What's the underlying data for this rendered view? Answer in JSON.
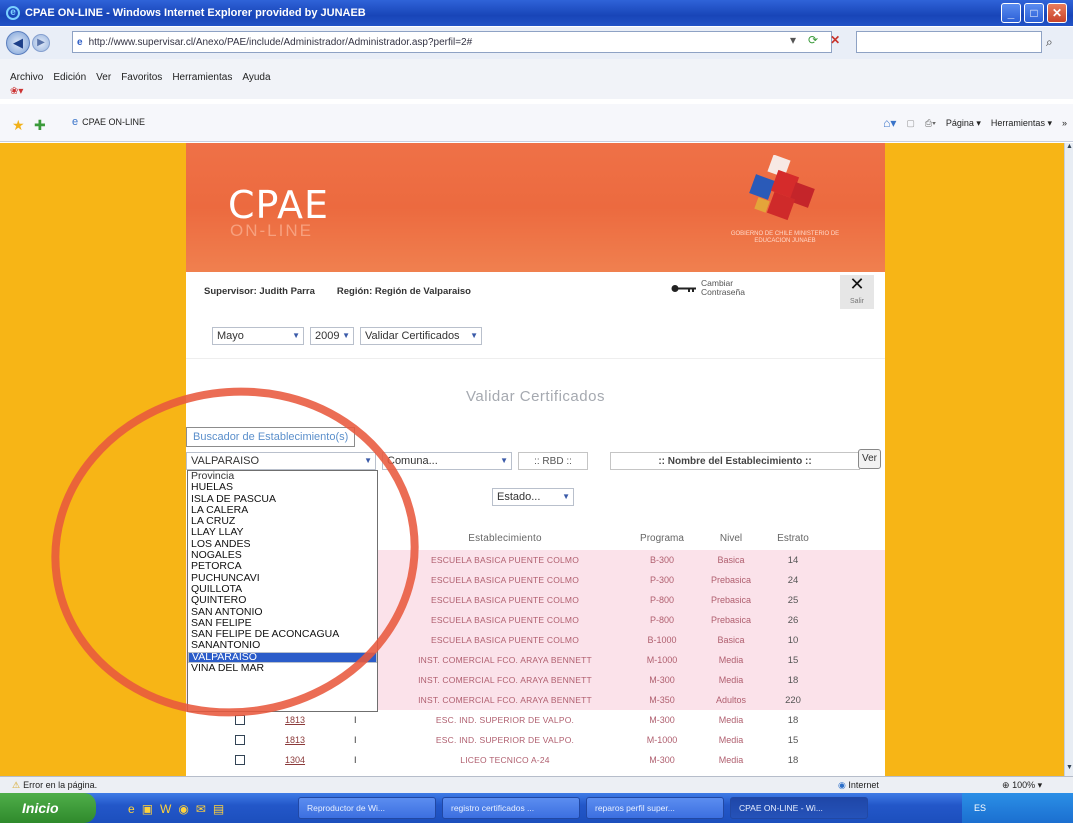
{
  "window": {
    "title": "CPAE ON-LINE - Windows Internet Explorer provided by JUNAEB"
  },
  "address": {
    "url": "http://www.supervisar.cl/Anexo/PAE/include/Administrador/Administrador.asp?perfil=2#"
  },
  "menu": [
    "Archivo",
    "Edición",
    "Ver",
    "Favoritos",
    "Herramientas",
    "Ayuda"
  ],
  "favorites": {
    "tab_label": "CPAE ON-LINE"
  },
  "command_bar": {
    "page_label": "Página",
    "tools_label": "Herramientas"
  },
  "banner": {
    "title": "CPAE",
    "subtitle": "ON-LINE",
    "logo_text": "GOBIERNO DE CHILE MINISTERIO DE EDUCACION JUNAEB"
  },
  "user": {
    "supervisor": "Supervisor: Judith Parra",
    "region": "Región: Región de Valparaiso",
    "change_password": "Cambiar Contraseña",
    "exit": "Salir"
  },
  "period": {
    "month": "Mayo",
    "year": "2009",
    "action": "Validar Certificados"
  },
  "page_title": "Validar Certificados",
  "search": {
    "legend": "Buscador de Establecimiento(s)",
    "province_value": "VALPARAISO",
    "comuna_placeholder": "Comuna...",
    "rbd_placeholder": ":: RBD ::",
    "name_placeholder": ":: Nombre del Establecimiento ::",
    "go_label": "Ver"
  },
  "estado_filter": "Estado...",
  "province_options": [
    "Provincia",
    "HUELAS",
    "ISLA DE PASCUA",
    "LA CALERA",
    "LA CRUZ",
    "LLAY LLAY",
    "LOS ANDES",
    "NOGALES",
    "PETORCA",
    "PUCHUNCAVI",
    "QUILLOTA",
    "QUINTERO",
    "SAN ANTONIO",
    "SAN FELIPE",
    "SAN FELIPE DE ACONCAGUA",
    "SANANTONIO",
    "VALPARAISO",
    "VINA DEL MAR"
  ],
  "province_selected_index": 16,
  "table": {
    "headers": [
      "Establecimiento",
      "Programa",
      "Nivel",
      "Estrato"
    ],
    "rows": [
      {
        "rbd": "",
        "tipo": "",
        "establecimiento": "ESCUELA BASICA PUENTE COLMO",
        "programa": "B-300",
        "nivel": "Basica",
        "estrato": "14"
      },
      {
        "rbd": "",
        "tipo": "",
        "establecimiento": "ESCUELA BASICA PUENTE COLMO",
        "programa": "P-300",
        "nivel": "Prebasica",
        "estrato": "24"
      },
      {
        "rbd": "",
        "tipo": "",
        "establecimiento": "ESCUELA BASICA PUENTE COLMO",
        "programa": "P-800",
        "nivel": "Prebasica",
        "estrato": "25"
      },
      {
        "rbd": "",
        "tipo": "",
        "establecimiento": "ESCUELA BASICA PUENTE COLMO",
        "programa": "P-800",
        "nivel": "Prebasica",
        "estrato": "26"
      },
      {
        "rbd": "",
        "tipo": "",
        "establecimiento": "ESCUELA BASICA PUENTE COLMO",
        "programa": "B-1000",
        "nivel": "Basica",
        "estrato": "10"
      },
      {
        "rbd": "",
        "tipo": "",
        "establecimiento": "INST. COMERCIAL FCO. ARAYA BENNETT",
        "programa": "M-1000",
        "nivel": "Media",
        "estrato": "15"
      },
      {
        "rbd": "",
        "tipo": "",
        "establecimiento": "INST. COMERCIAL FCO. ARAYA BENNETT",
        "programa": "M-300",
        "nivel": "Media",
        "estrato": "18"
      },
      {
        "rbd": "",
        "tipo": "",
        "establecimiento": "INST. COMERCIAL FCO. ARAYA BENNETT",
        "programa": "M-350",
        "nivel": "Adultos",
        "estrato": "220"
      },
      {
        "rbd": "1813",
        "tipo": "I",
        "establecimiento": "ESC. IND. SUPERIOR DE VALPO.",
        "programa": "M-300",
        "nivel": "Media",
        "estrato": "18"
      },
      {
        "rbd": "1813",
        "tipo": "I",
        "establecimiento": "ESC. IND. SUPERIOR DE VALPO.",
        "programa": "M-1000",
        "nivel": "Media",
        "estrato": "15"
      },
      {
        "rbd": "1304",
        "tipo": "I",
        "establecimiento": "LICEO TECNICO A-24",
        "programa": "M-300",
        "nivel": "Media",
        "estrato": "18"
      }
    ]
  },
  "statusbar": {
    "error": "Error en la página.",
    "zone": "Internet",
    "zoom": "100%"
  },
  "taskbar": {
    "start": "Inicio",
    "buttons": [
      "Reproductor de Wi...",
      "registro certificados ...",
      "reparos perfil super...",
      "CPAE ON-LINE - Wi..."
    ],
    "tray": "ES"
  },
  "colors": {
    "orange_bg": "#f7b516",
    "banner": "#ec6a3f",
    "annotation": "#e8593d",
    "selection": "#2b5cc9"
  }
}
